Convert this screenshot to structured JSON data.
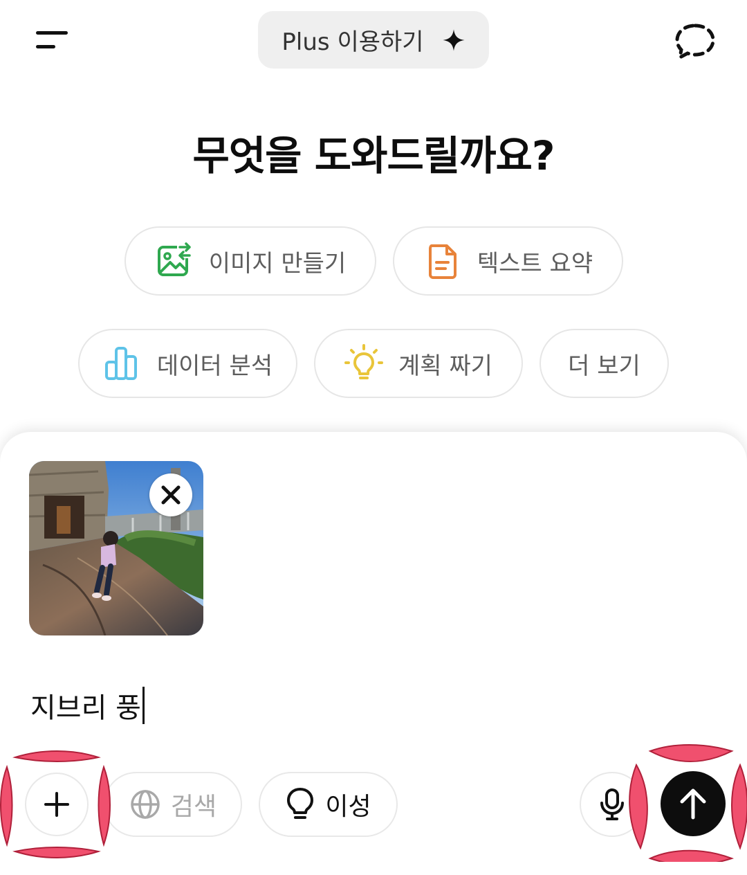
{
  "header": {
    "menu_icon": "hamburger-menu-icon",
    "upgrade_label": "Plus 이용하기",
    "upgrade_icon": "sparkle-icon",
    "temp_chat_icon": "dashed-chat-bubble-icon"
  },
  "headline": "무엇을 도와드릴까요?",
  "suggestions": [
    {
      "label": "이미지 만들기",
      "icon": "image-create-icon",
      "color": "#2fa84f"
    },
    {
      "label": "텍스트 요약",
      "icon": "document-icon",
      "color": "#e8833a"
    },
    {
      "label": "데이터 분석",
      "icon": "bar-chart-icon",
      "color": "#5ec3e8"
    },
    {
      "label": "계획 짜기",
      "icon": "lightbulb-icon",
      "color": "#e9c53a"
    },
    {
      "label": "더 보기",
      "icon": "",
      "color": ""
    }
  ],
  "composer": {
    "attachment": {
      "kind": "photo",
      "description_icon": "image-thumbnail"
    },
    "remove_icon": "close-icon",
    "input_value": "지브리 풍"
  },
  "toolbar": {
    "add_icon": "plus-icon",
    "search_label": "검색",
    "search_icon": "globe-icon",
    "reason_label": "이성",
    "reason_icon": "lightbulb-outline-icon",
    "mic_icon": "microphone-icon",
    "send_icon": "arrow-up-icon"
  },
  "colors": {
    "accent_burst": "#f0506e",
    "send_bg": "#0d0d0d",
    "pill_bg": "#efefef"
  }
}
